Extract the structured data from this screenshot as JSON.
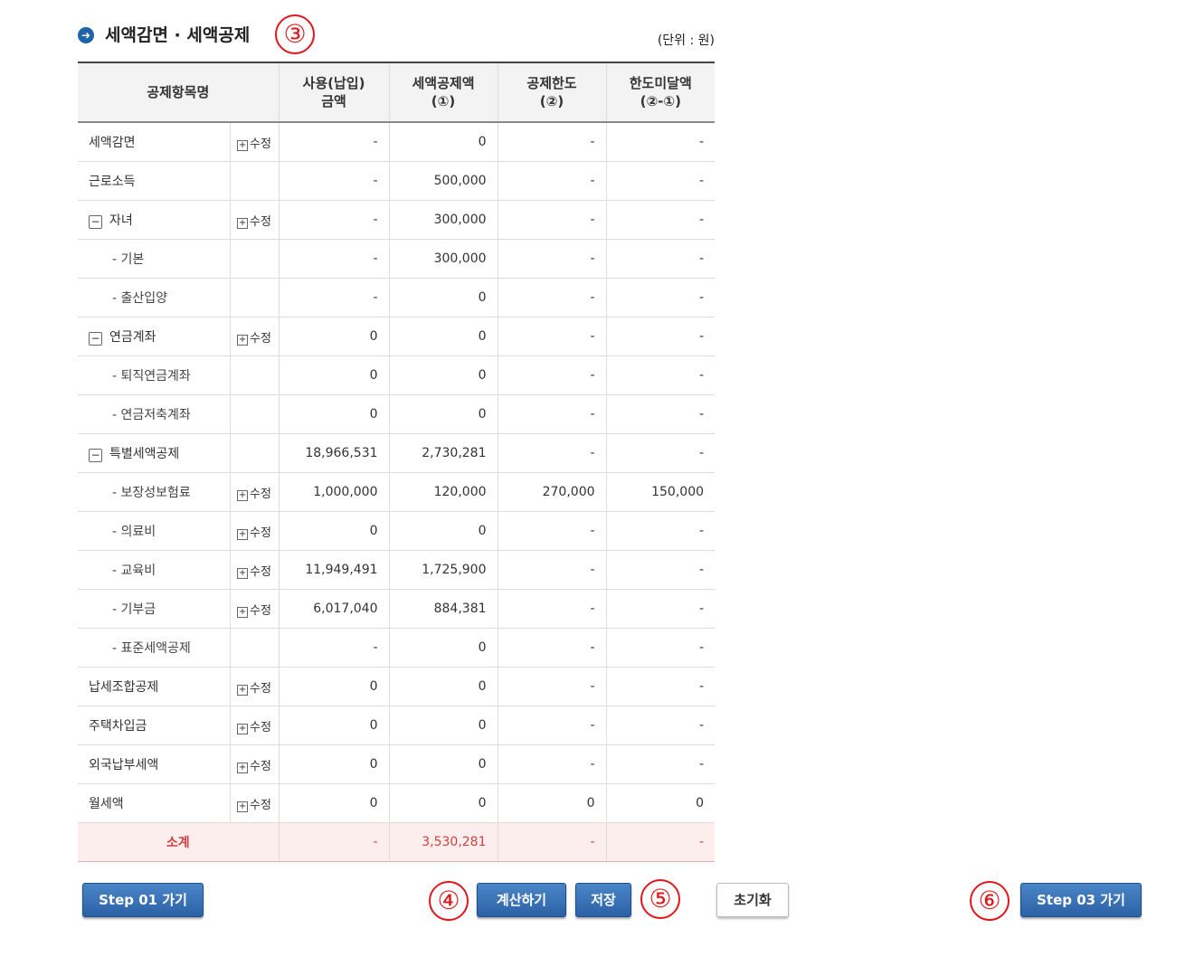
{
  "section": {
    "bullet_icon": "arrow-right-circle-icon",
    "title": "세액감면 · 세액공제",
    "unit": "(단위 : 원)"
  },
  "table": {
    "headers": {
      "name": "공제항목명",
      "used_line1": "사용(납입)",
      "used_line2": "금액",
      "deduction_line1": "세액공제액",
      "deduction_line2": "(①)",
      "limit_line1": "공제한도",
      "limit_line2": "(②)",
      "shortfall_line1": "한도미달액",
      "shortfall_line2": "(②-①)"
    },
    "edit_label": "수정",
    "rows": [
      {
        "name": "세액감면",
        "used": "-",
        "deduction": "0",
        "limit": "-",
        "shortfall": "-"
      },
      {
        "name": "근로소득",
        "used": "-",
        "deduction": "500,000",
        "limit": "-",
        "shortfall": "-"
      },
      {
        "name": "자녀",
        "used": "-",
        "deduction": "300,000",
        "limit": "-",
        "shortfall": "-"
      },
      {
        "name": "- 기본",
        "used": "-",
        "deduction": "300,000",
        "limit": "-",
        "shortfall": "-"
      },
      {
        "name": "- 출산입양",
        "used": "-",
        "deduction": "0",
        "limit": "-",
        "shortfall": "-"
      },
      {
        "name": "연금계좌",
        "used": "0",
        "deduction": "0",
        "limit": "-",
        "shortfall": "-"
      },
      {
        "name": "- 퇴직연금계좌",
        "used": "0",
        "deduction": "0",
        "limit": "-",
        "shortfall": "-"
      },
      {
        "name": "- 연금저축계좌",
        "used": "0",
        "deduction": "0",
        "limit": "-",
        "shortfall": "-"
      },
      {
        "name": "특별세액공제",
        "used": "18,966,531",
        "deduction": "2,730,281",
        "limit": "-",
        "shortfall": "-"
      },
      {
        "name": "- 보장성보험료",
        "used": "1,000,000",
        "deduction": "120,000",
        "limit": "270,000",
        "shortfall": "150,000"
      },
      {
        "name": "- 의료비",
        "used": "0",
        "deduction": "0",
        "limit": "-",
        "shortfall": "-"
      },
      {
        "name": "- 교육비",
        "used": "11,949,491",
        "deduction": "1,725,900",
        "limit": "-",
        "shortfall": "-"
      },
      {
        "name": "- 기부금",
        "used": "6,017,040",
        "deduction": "884,381",
        "limit": "-",
        "shortfall": "-"
      },
      {
        "name": "- 표준세액공제",
        "used": "-",
        "deduction": "0",
        "limit": "-",
        "shortfall": "-"
      },
      {
        "name": "납세조합공제",
        "used": "0",
        "deduction": "0",
        "limit": "-",
        "shortfall": "-"
      },
      {
        "name": "주택차입금",
        "used": "0",
        "deduction": "0",
        "limit": "-",
        "shortfall": "-"
      },
      {
        "name": "외국납부세액",
        "used": "0",
        "deduction": "0",
        "limit": "-",
        "shortfall": "-"
      },
      {
        "name": "월세액",
        "used": "0",
        "deduction": "0",
        "limit": "0",
        "shortfall": "0"
      }
    ],
    "total": {
      "label": "소계",
      "used": "-",
      "deduction": "3,530,281",
      "limit": "-",
      "shortfall": "-"
    }
  },
  "buttons": {
    "step01": "Step 01 가기",
    "calculate": "계산하기",
    "save": "저장",
    "reset": "초기화",
    "step03": "Step 03 가기"
  },
  "annotations": {
    "n3": "③",
    "n4": "④",
    "n5": "⑤",
    "n6": "⑥"
  },
  "colors": {
    "primary_button": "#2b62a5",
    "annotation": "#e0161b",
    "total_row_bg": "#fdeeee",
    "total_row_text": "#d04040"
  }
}
